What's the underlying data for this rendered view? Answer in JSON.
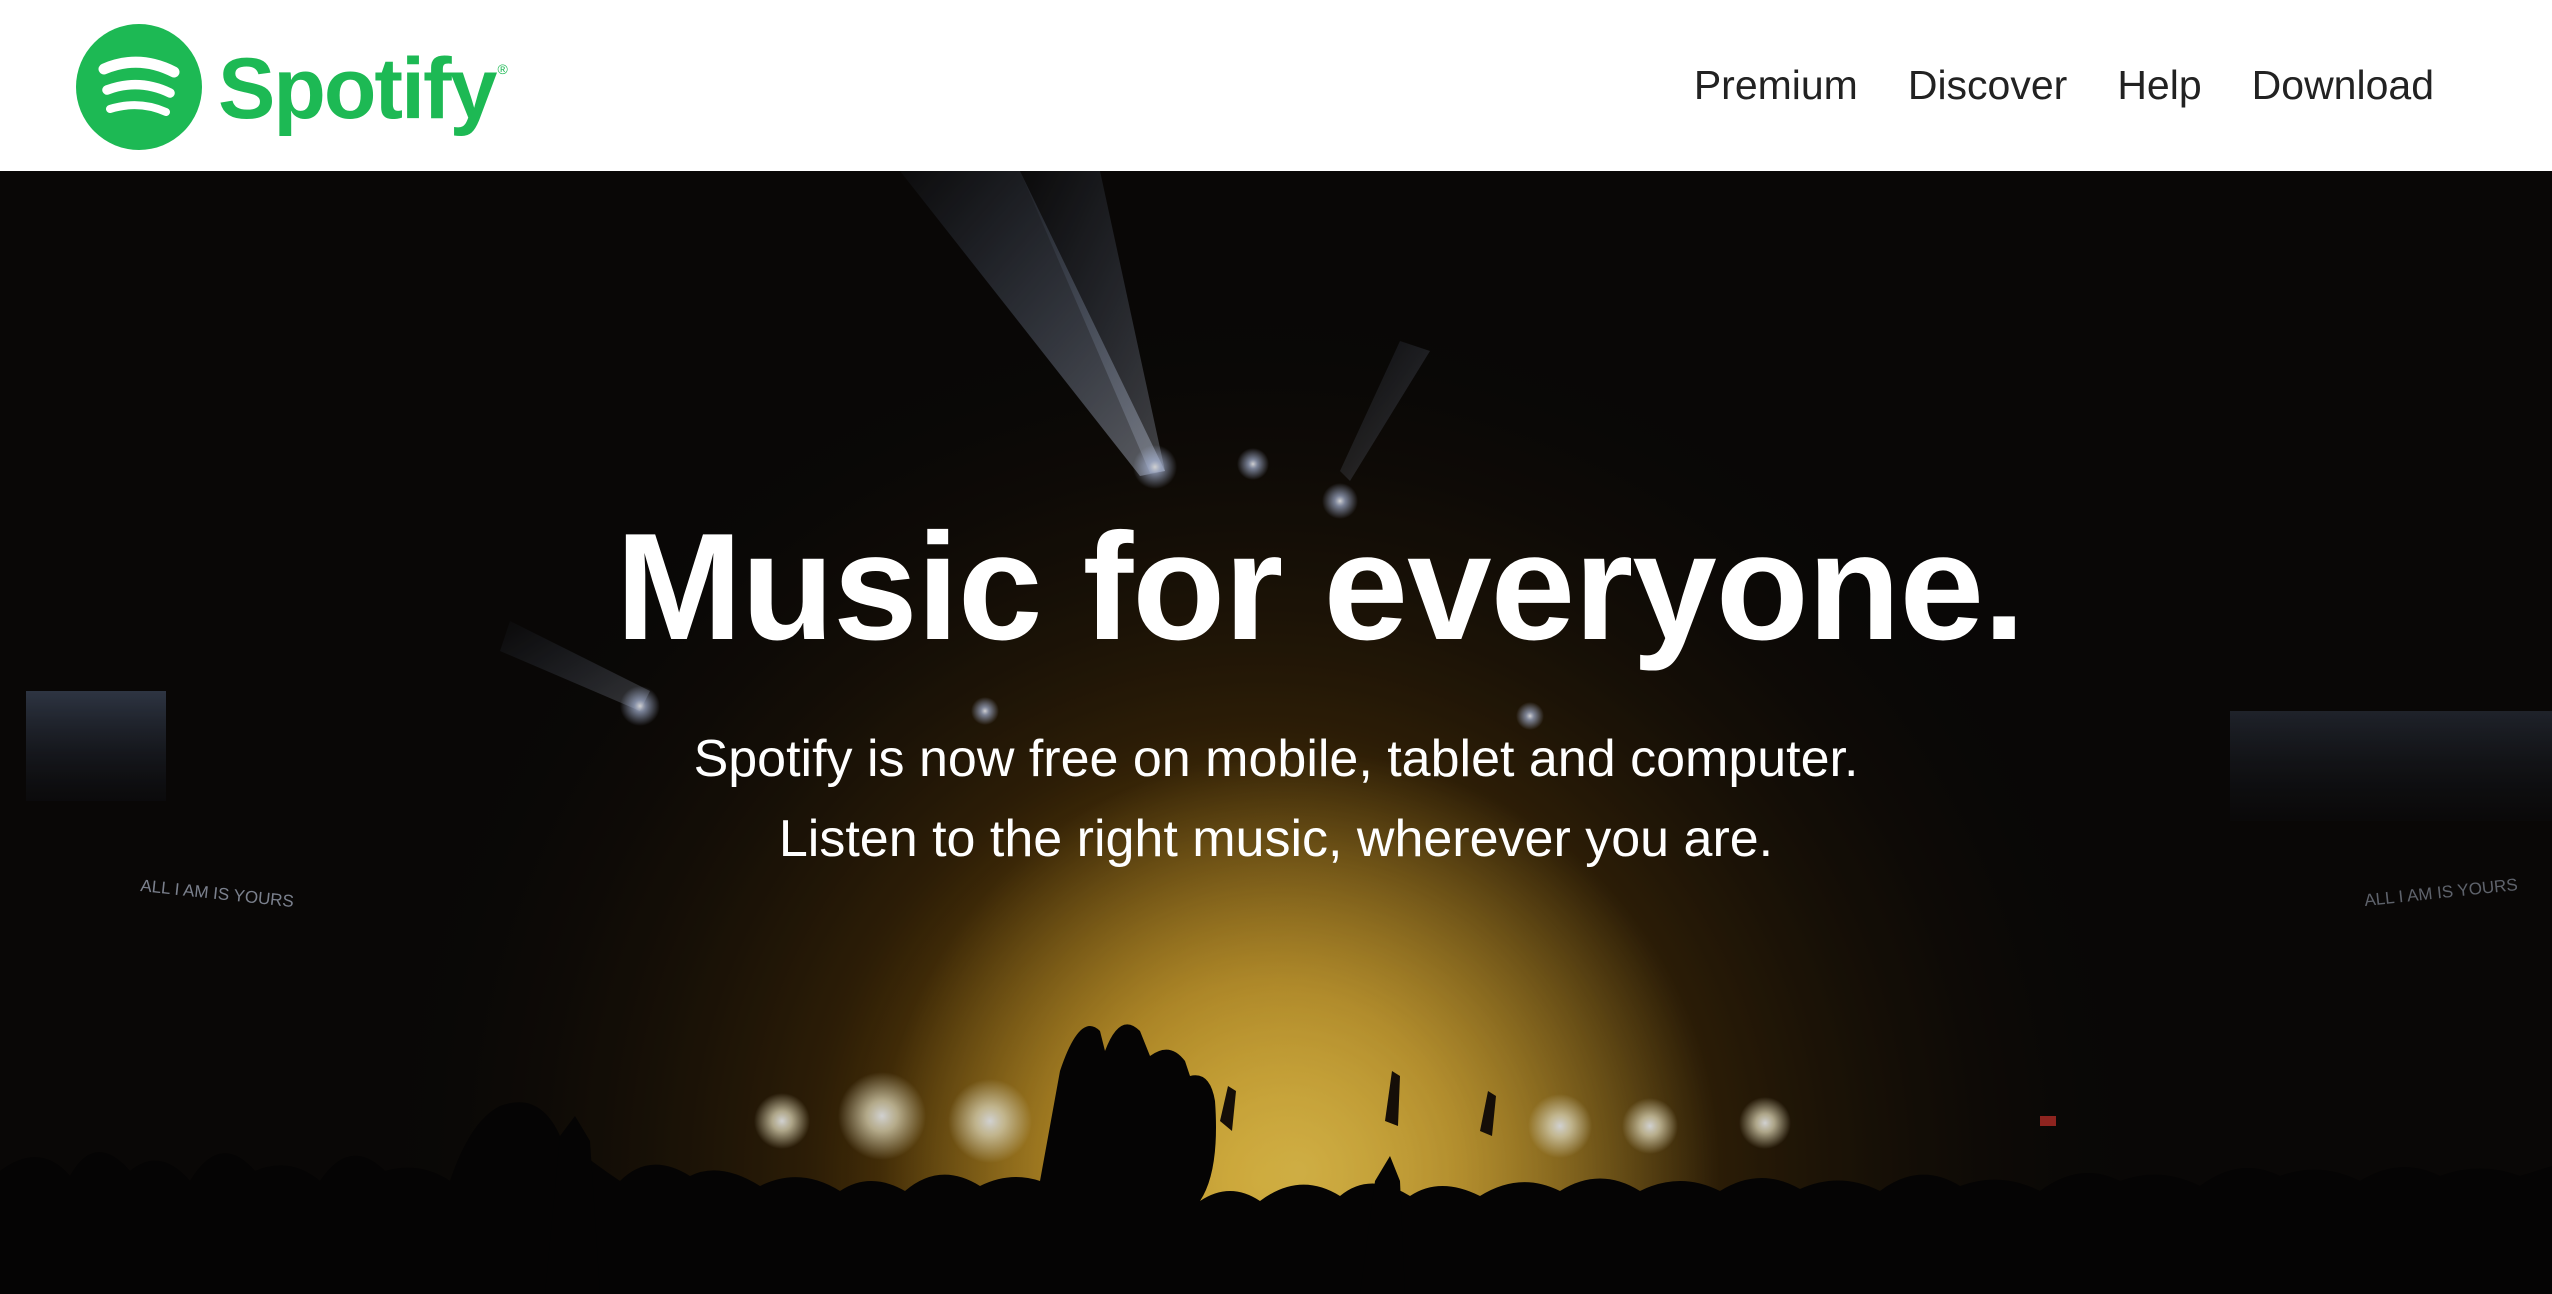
{
  "brand": {
    "name": "Spotify",
    "registered_mark": "®",
    "color": "#1DB954"
  },
  "nav": {
    "items": [
      {
        "label": "Premium"
      },
      {
        "label": "Discover"
      },
      {
        "label": "Help"
      },
      {
        "label": "Download"
      }
    ]
  },
  "hero": {
    "title": "Music for everyone.",
    "subtitle_line1": "Spotify is now free on mobile, tablet and computer.",
    "subtitle_line2": "Listen to the right music, wherever you are.",
    "screen_text": "ALL I AM IS YOURS"
  }
}
